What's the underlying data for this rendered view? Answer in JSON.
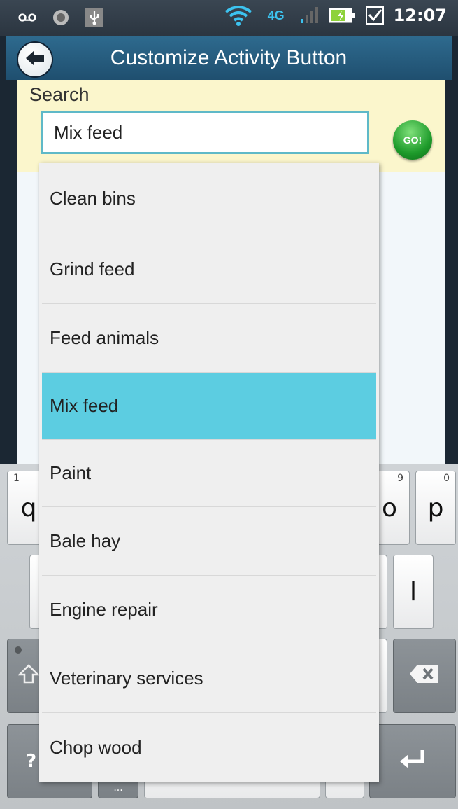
{
  "status_bar": {
    "time": "12:07",
    "network": "4G",
    "icons": [
      "voicemail-icon",
      "record-icon",
      "usb-icon",
      "wifi-icon",
      "network-4g-icon",
      "signal-icon",
      "battery-charging-icon",
      "checkbox-icon"
    ]
  },
  "header": {
    "title": "Customize Activity Button",
    "back_icon": "back-arrow-icon"
  },
  "search": {
    "label": "Search",
    "value": "Mix feed",
    "go_label": "GO!"
  },
  "dropdown": {
    "items": [
      {
        "label": "Clean bins"
      },
      {
        "label": "Grind feed"
      },
      {
        "label": "Feed animals"
      },
      {
        "label": "Mix feed",
        "selected": true
      },
      {
        "label": "Paint"
      },
      {
        "label": "Bale hay"
      },
      {
        "label": "Engine repair"
      },
      {
        "label": "Veterinary services"
      },
      {
        "label": "Chop wood"
      }
    ]
  },
  "keyboard": {
    "q": "q",
    "q_hint": "1",
    "o": "o",
    "o_hint": "9",
    "p": "p",
    "p_hint": "0",
    "l": "l",
    "symbols_label": "?",
    "dots_label": "...",
    "backspace_icon": "backspace-icon",
    "enter_icon": "enter-icon",
    "shift_icon": "shift-icon"
  },
  "colors": {
    "accent": "#5ccde1",
    "search_panel_bg": "#fbf6cc",
    "title_bar": "#2e6a8e",
    "go_button": "#1e9b2b"
  }
}
